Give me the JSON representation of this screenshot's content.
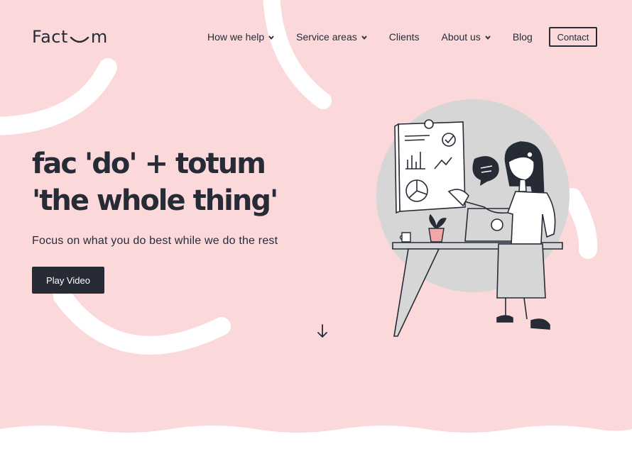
{
  "brand": {
    "logo_text_before": "Fact",
    "logo_text_after": "m"
  },
  "nav": {
    "items": [
      {
        "label": "How we help",
        "dropdown": true
      },
      {
        "label": "Service areas",
        "dropdown": true
      },
      {
        "label": "Clients",
        "dropdown": false
      },
      {
        "label": "About us",
        "dropdown": true
      },
      {
        "label": "Blog",
        "dropdown": false
      }
    ],
    "contact_label": "Contact"
  },
  "hero": {
    "title_line1": "fac 'do' + totum",
    "title_line2": "'the whole thing'",
    "tagline": "Focus on what you do best while we do the rest",
    "cta_label": "Play Video"
  },
  "icons": {
    "chevron": "chevron-down-icon",
    "scroll": "arrow-down-icon",
    "illustration": "woman-presenting-chart-illustration"
  },
  "colors": {
    "background": "#fbd9db",
    "text": "#262b36",
    "button": "#262b36",
    "illustration_circle": "#d6d6d6",
    "white": "#ffffff"
  }
}
